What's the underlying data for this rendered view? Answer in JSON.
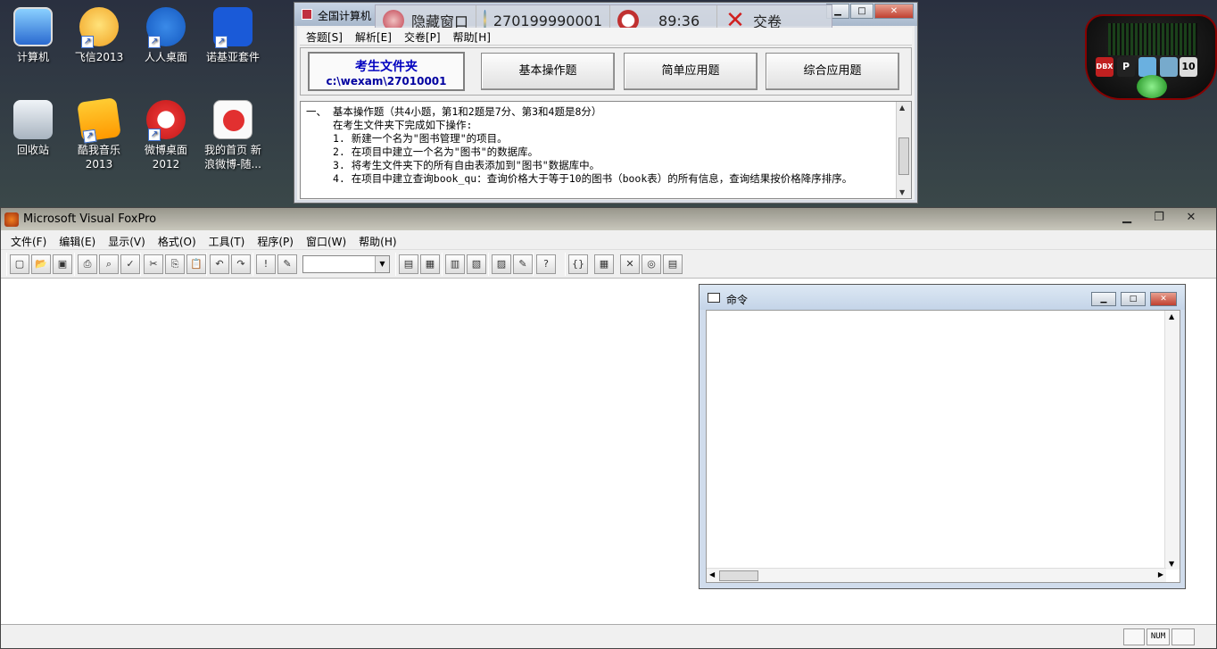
{
  "desktop": {
    "icons": [
      {
        "label": "计算机"
      },
      {
        "label": "飞信2013"
      },
      {
        "label": "人人桌面"
      },
      {
        "label": "诺基亚套件"
      },
      {
        "label": "回收站"
      },
      {
        "label": "酷我音乐2013"
      },
      {
        "label": "微博桌面2012"
      },
      {
        "label": "我的首页 新浪微博-随..."
      }
    ]
  },
  "exam_window": {
    "title": "全国计算机",
    "overlay": {
      "hide_label": "隐藏窗口",
      "candidate_id": "270199990001",
      "timer": "89:36",
      "submit_label": "交卷"
    },
    "menu": [
      "答题[S]",
      "解析[E]",
      "交卷[P]",
      "帮助[H]"
    ],
    "folder": {
      "title": "考生文件夹",
      "path": "c:\\wexam\\27010001"
    },
    "buttons": [
      "基本操作题",
      "简单应用题",
      "综合应用题"
    ],
    "question": {
      "heading": "一、 基本操作题（共4小题，第1和2题是7分、第3和4题是8分）",
      "intro": "在考生文件夹下完成如下操作:",
      "items": [
        "1. 新建一个名为\"图书管理\"的项目。",
        "2. 在项目中建立一个名为\"图书\"的数据库。",
        "3. 将考生文件夹下的所有自由表添加到\"图书\"数据库中。",
        "4. 在项目中建立查询book_qu：查询价格大于等于10的图书（book表）的所有信息，查询结果按价格降序排序。"
      ]
    }
  },
  "gadget": {
    "buttons": [
      "DBX",
      "P",
      "10"
    ]
  },
  "vfp": {
    "title": "Microsoft Visual FoxPro",
    "menu": [
      "文件(F)",
      "编辑(E)",
      "显示(V)",
      "格式(O)",
      "工具(T)",
      "程序(P)",
      "窗口(W)",
      "帮助(H)"
    ],
    "status": {
      "num": "NUM"
    }
  },
  "command_window": {
    "title": "命令"
  }
}
